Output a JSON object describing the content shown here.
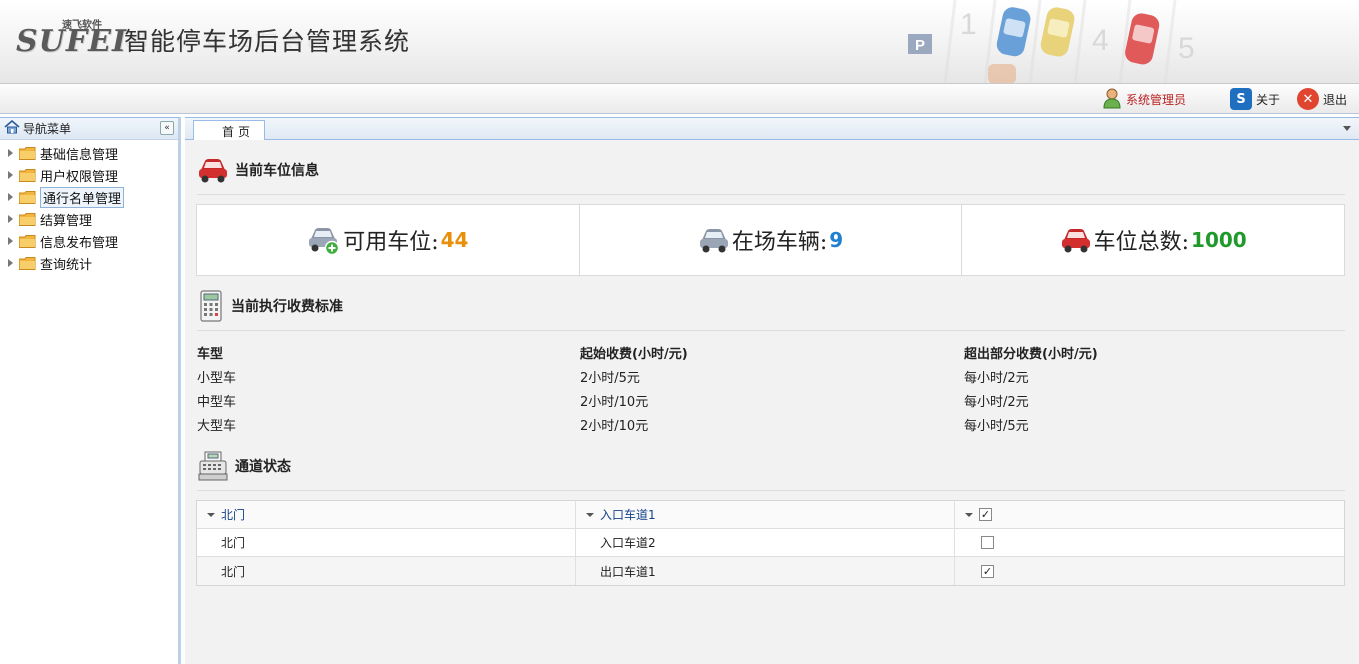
{
  "header": {
    "logo_text": "SUFEI",
    "logo_sub": "速飞软件",
    "title": "智能停车场后台管理系统",
    "deco_digits": [
      "1",
      "4",
      "5"
    ],
    "deco_parking": "P"
  },
  "toolbar": {
    "admin_label": "系统管理员",
    "about_label": "关于",
    "exit_label": "退出"
  },
  "sidebar": {
    "title": "导航菜单",
    "items": [
      {
        "label": "基础信息管理"
      },
      {
        "label": "用户权限管理"
      },
      {
        "label": "通行名单管理"
      },
      {
        "label": "结算管理"
      },
      {
        "label": "信息发布管理"
      },
      {
        "label": "查询统计"
      }
    ]
  },
  "tabs": [
    {
      "label": "首页"
    }
  ],
  "parking": {
    "title": "当前车位信息",
    "available_label": "可用车位:",
    "available_value": "44",
    "present_label": "在场车辆:",
    "present_value": "9",
    "total_label": "车位总数:",
    "total_value": "1000"
  },
  "fees": {
    "title": "当前执行收费标准",
    "headers": [
      "车型",
      "起始收费(小时/元)",
      "超出部分收费(小时/元)"
    ],
    "rows": [
      [
        "小型车",
        "2小时/5元",
        "每小时/2元"
      ],
      [
        "中型车",
        "2小时/10元",
        "每小时/2元"
      ],
      [
        "大型车",
        "2小时/10元",
        "每小时/5元"
      ]
    ]
  },
  "channels": {
    "title": "通道状态",
    "rows": [
      {
        "gate": "北门",
        "lane": "入口车道1",
        "checked": true,
        "group": true
      },
      {
        "gate": "北门",
        "lane": "入口车道2",
        "checked": false,
        "group": false
      },
      {
        "gate": "北门",
        "lane": "出口车道1",
        "checked": true,
        "group": false
      }
    ]
  },
  "colors": {
    "available": "#e8900a",
    "present": "#1f7fd0",
    "total": "#1f9a2a"
  }
}
